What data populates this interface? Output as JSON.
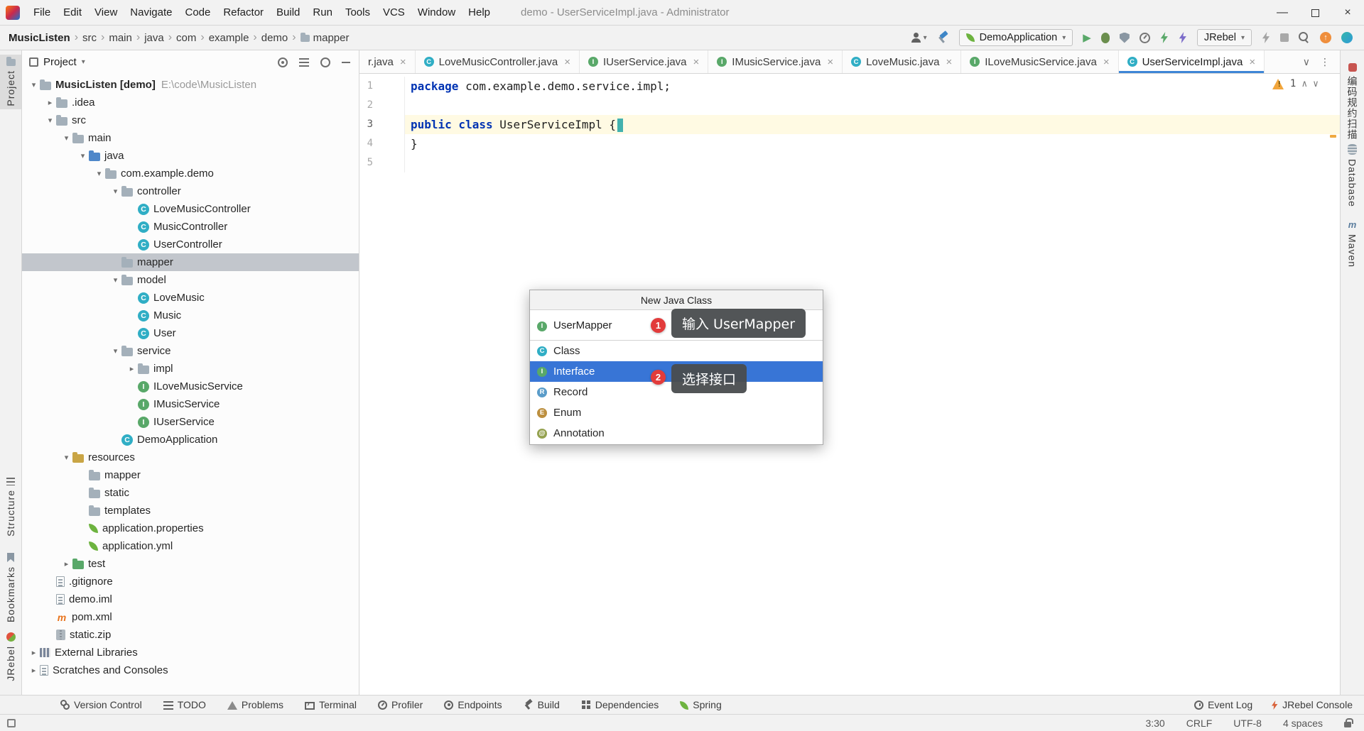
{
  "window": {
    "title": "demo - UserServiceImpl.java - Administrator",
    "menus": [
      "File",
      "Edit",
      "View",
      "Navigate",
      "Code",
      "Refactor",
      "Build",
      "Run",
      "Tools",
      "VCS",
      "Window",
      "Help"
    ]
  },
  "toolbar": {
    "breadcrumbs": [
      "MusicListen",
      "src",
      "main",
      "java",
      "com",
      "example",
      "demo",
      "mapper"
    ],
    "run_config": "DemoApplication",
    "jrebel_label": "JRebel"
  },
  "left_strip": {
    "items": [
      {
        "label": "Project",
        "icon": "si-folder"
      },
      {
        "label": "Structure",
        "icon": "si-list"
      },
      {
        "label": "Bookmarks",
        "icon": "si-bookmark"
      },
      {
        "label": "JRebel",
        "icon": "si-jrebel"
      }
    ]
  },
  "right_strip": {
    "items": [
      {
        "label": "编码规约扫描",
        "icon": "si-plugin"
      },
      {
        "label": "Database",
        "icon": "si-db"
      },
      {
        "label": "Maven",
        "icon": "si-maven"
      }
    ]
  },
  "project": {
    "header": {
      "title": "Project"
    },
    "tree": [
      {
        "label": "MusicListen [demo]",
        "suffix": "E:\\code\\MusicListen",
        "level": 0,
        "icon": "project-folder",
        "chevron": "expanded",
        "bold": true
      },
      {
        "label": ".idea",
        "level": 1,
        "icon": "folder",
        "chevron": "collapsed"
      },
      {
        "label": "src",
        "level": 1,
        "icon": "folder",
        "chevron": "expanded"
      },
      {
        "label": "main",
        "level": 2,
        "icon": "folder",
        "chevron": "expanded"
      },
      {
        "label": "java",
        "level": 3,
        "icon": "folder-src",
        "chevron": "expanded"
      },
      {
        "label": "com.example.demo",
        "level": 4,
        "icon": "package",
        "chevron": "expanded"
      },
      {
        "label": "controller",
        "level": 5,
        "icon": "package",
        "chevron": "expanded"
      },
      {
        "label": "LoveMusicController",
        "level": 6,
        "icon": "class"
      },
      {
        "label": "MusicController",
        "level": 6,
        "icon": "class"
      },
      {
        "label": "UserController",
        "level": 6,
        "icon": "class"
      },
      {
        "label": "mapper",
        "level": 5,
        "icon": "package",
        "selected": true
      },
      {
        "label": "model",
        "level": 5,
        "icon": "package",
        "chevron": "expanded"
      },
      {
        "label": "LoveMusic",
        "level": 6,
        "icon": "class"
      },
      {
        "label": "Music",
        "level": 6,
        "icon": "class"
      },
      {
        "label": "User",
        "level": 6,
        "icon": "class"
      },
      {
        "label": "service",
        "level": 5,
        "icon": "package",
        "chevron": "expanded"
      },
      {
        "label": "impl",
        "level": 6,
        "icon": "package",
        "chevron": "collapsed"
      },
      {
        "label": "ILoveMusicService",
        "level": 6,
        "icon": "interface"
      },
      {
        "label": "IMusicService",
        "level": 6,
        "icon": "interface"
      },
      {
        "label": "IUserService",
        "level": 6,
        "icon": "interface"
      },
      {
        "label": "DemoApplication",
        "level": 5,
        "icon": "class"
      },
      {
        "label": "resources",
        "level": 2,
        "icon": "folder-res",
        "chevron": "expanded"
      },
      {
        "label": "mapper",
        "level": 3,
        "icon": "folder"
      },
      {
        "label": "static",
        "level": 3,
        "icon": "folder"
      },
      {
        "label": "templates",
        "level": 3,
        "icon": "folder"
      },
      {
        "label": "application.properties",
        "level": 3,
        "icon": "spring"
      },
      {
        "label": "application.yml",
        "level": 3,
        "icon": "spring"
      },
      {
        "label": "test",
        "level": 2,
        "icon": "folder-test",
        "chevron": "collapsed"
      },
      {
        "label": ".gitignore",
        "level": 1,
        "icon": "file"
      },
      {
        "label": "demo.iml",
        "level": 1,
        "icon": "file"
      },
      {
        "label": "pom.xml",
        "level": 1,
        "icon": "maven-file"
      },
      {
        "label": "static.zip",
        "level": 1,
        "icon": "zip"
      },
      {
        "label": "External Libraries",
        "level": 0,
        "icon": "libraries",
        "chevron": "collapsed"
      },
      {
        "label": "Scratches and Consoles",
        "level": 0,
        "icon": "file",
        "chevron": "collapsed"
      }
    ]
  },
  "editor": {
    "tabs": [
      {
        "label": "r.java",
        "icon": "none"
      },
      {
        "label": "LoveMusicController.java",
        "icon": "class"
      },
      {
        "label": "IUserService.java",
        "icon": "interface"
      },
      {
        "label": "IMusicService.java",
        "icon": "interface"
      },
      {
        "label": "LoveMusic.java",
        "icon": "class"
      },
      {
        "label": "ILoveMusicService.java",
        "icon": "interface"
      },
      {
        "label": "UserServiceImpl.java",
        "icon": "class",
        "active": true
      }
    ],
    "lines": [
      {
        "num": "1",
        "segments": [
          {
            "t": "package ",
            "c": "kw"
          },
          {
            "t": "com.example.demo.service.impl;",
            "c": "pl"
          }
        ]
      },
      {
        "num": "2",
        "segments": []
      },
      {
        "num": "3",
        "caret": true,
        "segments": [
          {
            "t": "public class ",
            "c": "kw"
          },
          {
            "t": "UserServiceImpl ",
            "c": "pl"
          },
          {
            "t": "{",
            "c": "pl"
          }
        ]
      },
      {
        "num": "4",
        "segments": [
          {
            "t": "}",
            "c": "pl"
          }
        ]
      },
      {
        "num": "5",
        "segments": []
      }
    ],
    "inspection": {
      "warning_count": "1"
    }
  },
  "dialog": {
    "title": "New Java Class",
    "name_value": "UserMapper",
    "name_icon": "interface",
    "options": [
      {
        "label": "Class",
        "icon": "class"
      },
      {
        "label": "Interface",
        "icon": "interface",
        "selected": true
      },
      {
        "label": "Record",
        "icon": "record"
      },
      {
        "label": "Enum",
        "icon": "enum"
      },
      {
        "label": "Annotation",
        "icon": "annotation"
      }
    ],
    "annotations": [
      {
        "num": "1",
        "tooltip": "输入 UserMapper"
      },
      {
        "num": "2",
        "tooltip": "选择接口"
      }
    ]
  },
  "bottom_bar": {
    "left": [
      {
        "label": "Version Control",
        "icon": "bi-branch"
      },
      {
        "label": "TODO",
        "icon": "bi-list"
      },
      {
        "label": "Problems",
        "icon": "bi-warn"
      },
      {
        "label": "Terminal",
        "icon": "bi-term"
      },
      {
        "label": "Profiler",
        "icon": "bi-gauge"
      },
      {
        "label": "Endpoints",
        "icon": "bi-endpoint"
      },
      {
        "label": "Build",
        "icon": "bi-hammer"
      },
      {
        "label": "Dependencies",
        "icon": "bi-deps"
      },
      {
        "label": "Spring",
        "icon": "bi-leaf"
      }
    ],
    "right": [
      {
        "label": "Event Log",
        "icon": "bi-clock"
      },
      {
        "label": "JRebel Console",
        "icon": "bi-bolt"
      }
    ]
  },
  "status_bar": {
    "items": [
      "3:30",
      "CRLF",
      "UTF-8",
      "4 spaces"
    ]
  },
  "colors": {
    "selection_blue": "#3875D6",
    "tree_selection_gray": "#C2C6CC",
    "badge_red": "#E23B3B",
    "caret_line_yellow": "#FFFAE3",
    "keyword_blue": "#0033B3",
    "spring_green": "#6DB33F",
    "active_tab_underline": "#3E86D6"
  }
}
